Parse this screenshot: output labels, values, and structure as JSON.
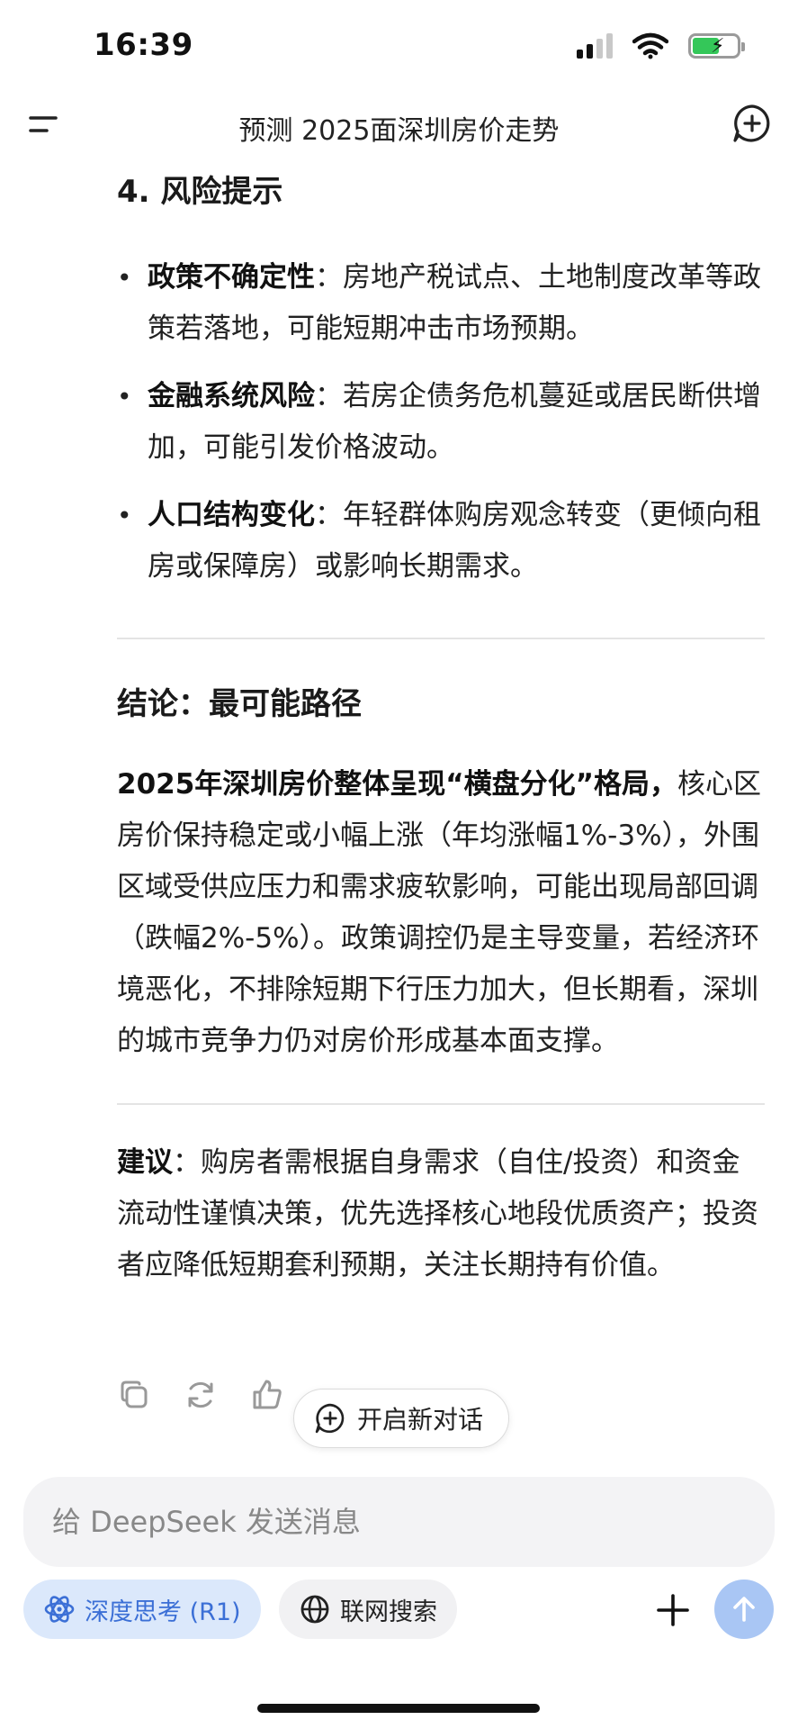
{
  "status_bar": {
    "time": "16:39"
  },
  "nav": {
    "title": "预测 2025面深圳房价走势"
  },
  "content": {
    "section_heading": "4. 风险提示",
    "bullets": [
      {
        "label": "政策不确定性",
        "sep": "：",
        "text": "房地产税试点、土地制度改革等政策若落地，可能短期冲击市场预期。"
      },
      {
        "label": "金融系统风险",
        "sep": "：",
        "text": "若房企债务危机蔓延或居民断供增加，可能引发价格波动。"
      },
      {
        "label": "人口结构变化",
        "sep": "：",
        "text": "年轻群体购房观念转变（更倾向租房或保障房）或影响长期需求。"
      }
    ],
    "conclusion_heading": "结论：最可能路径",
    "conclusion_bold": "2025年深圳房价整体呈现“横盘分化”格局，",
    "conclusion_text": "核心区房价保持稳定或小幅上涨（年均涨幅1%-3%），外围区域受供应压力和需求疲软影响，可能出现局部回调（跌幅2%-5%）。政策调控仍是主导变量，若经济环境恶化，不排除短期下行压力加大，但长期看，深圳的城市竞争力仍对房价形成基本面支撑。",
    "advice_label": "建议",
    "advice_sep": "：",
    "advice_text": "购房者需根据自身需求（自住/投资）和资金流动性谨慎决策，优先选择核心地段优质资产；投资者应降低短期套利预期，关注长期持有价值。"
  },
  "actions": {
    "new_chat_label": "开启新对话"
  },
  "composer": {
    "placeholder": "给 DeepSeek 发送消息",
    "deep_think_label": "深度思考 (R1)",
    "web_search_label": "联网搜索"
  },
  "colors": {
    "accent": "#3b6fd6",
    "send_button": "#a9c6f4",
    "battery": "#34c759"
  },
  "icons": [
    "menu-icon",
    "new-chat-icon",
    "copy-icon",
    "regenerate-icon",
    "thumbs-up-icon",
    "atom-icon",
    "globe-icon",
    "plus-icon",
    "arrow-up-icon"
  ]
}
